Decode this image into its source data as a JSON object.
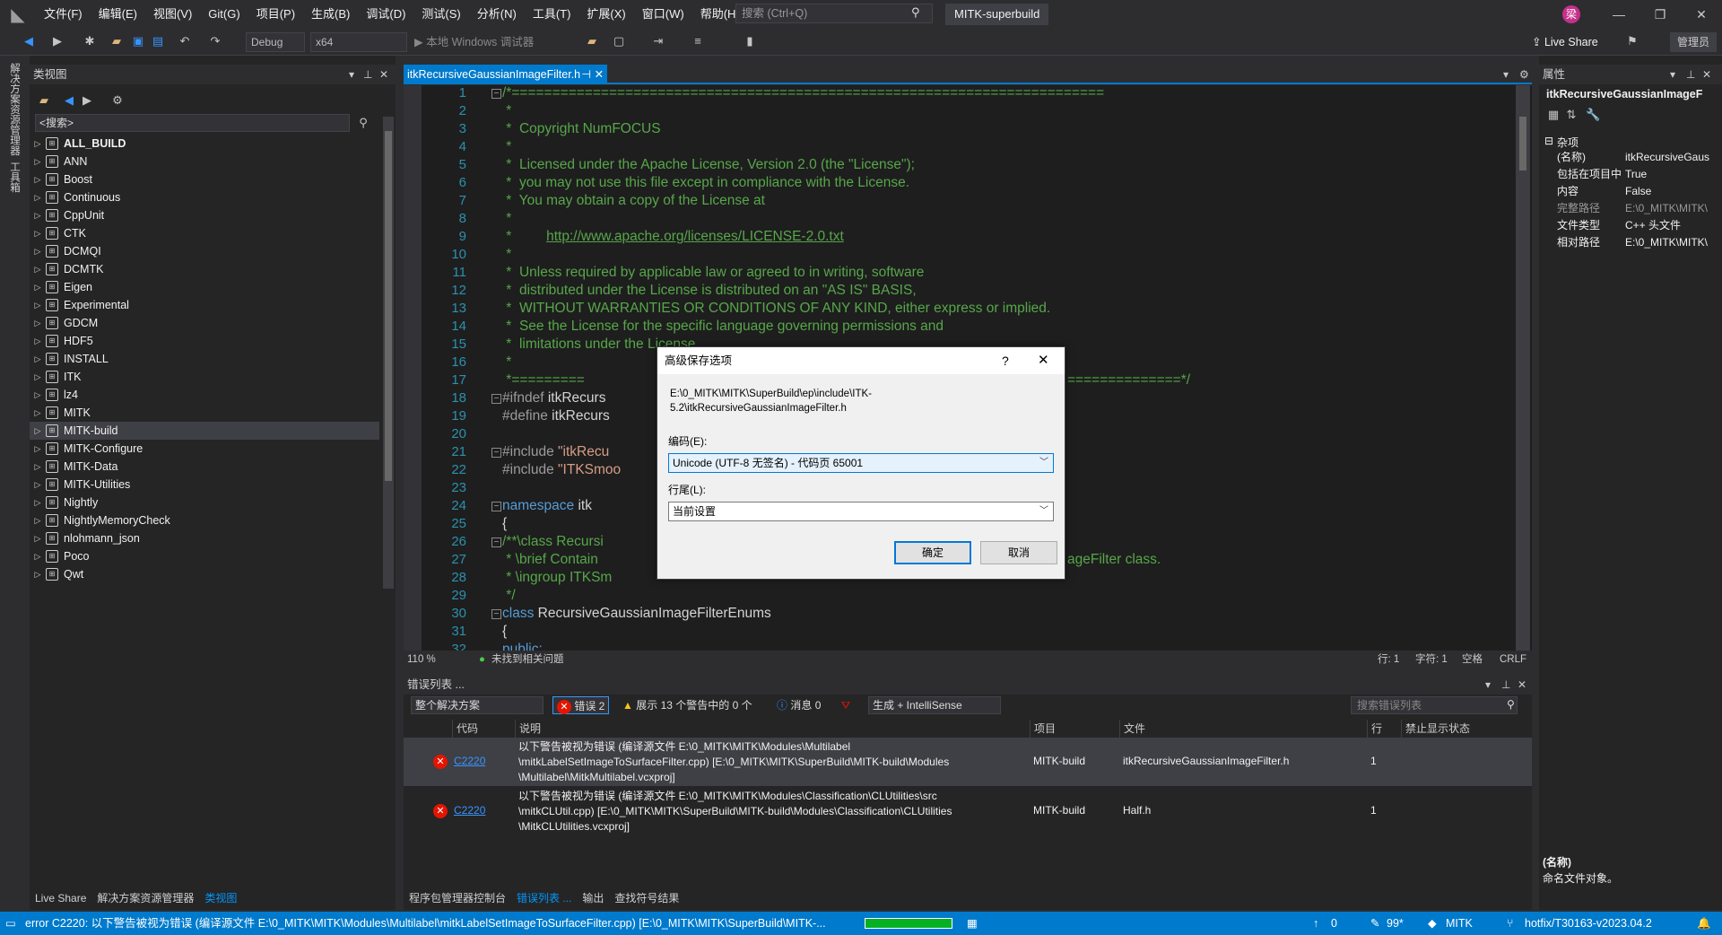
{
  "menubar": {
    "items": [
      "文件(F)",
      "编辑(E)",
      "视图(V)",
      "Git(G)",
      "项目(P)",
      "生成(B)",
      "调试(D)",
      "测试(S)",
      "分析(N)",
      "工具(T)",
      "扩展(X)",
      "窗口(W)",
      "帮助(H)"
    ],
    "search_placeholder": "搜索 (Ctrl+Q)",
    "solution_name": "MITK-superbuild",
    "avatar_initial": "梁"
  },
  "toolbar": {
    "config": "Debug",
    "platform": "x64",
    "debug_target": "本地 Windows 调试器",
    "live_share": "Live Share",
    "admin_label": "管理员"
  },
  "leftstrip": {
    "tabs": [
      "解决方案资源管理器",
      "工具箱"
    ]
  },
  "classview": {
    "title": "类视图",
    "search_placeholder": "<搜索>",
    "items": [
      "ALL_BUILD",
      "ANN",
      "Boost",
      "Continuous",
      "CppUnit",
      "CTK",
      "DCMQI",
      "DCMTK",
      "Eigen",
      "Experimental",
      "GDCM",
      "HDF5",
      "INSTALL",
      "ITK",
      "lz4",
      "MITK",
      "MITK-build",
      "MITK-Configure",
      "MITK-Data",
      "MITK-Utilities",
      "Nightly",
      "NightlyMemoryCheck",
      "nlohmann_json",
      "Poco",
      "Qwt"
    ],
    "selected_item": "MITK-build",
    "bottom_tabs": [
      "Live Share",
      "解决方案资源管理器",
      "类视图"
    ]
  },
  "editor": {
    "tab_title": "itkRecursiveGaussianImageFilter.h",
    "zoom": "110 %",
    "issues": "未找到相关问题",
    "line": "行: 1",
    "char": "字符: 1",
    "space": "空格",
    "eol": "CRLF",
    "line_numbers": [
      "1",
      "2",
      "3",
      "4",
      "5",
      "6",
      "7",
      "8",
      "9",
      "10",
      "11",
      "12",
      "13",
      "14",
      "15",
      "16",
      "17",
      "18",
      "19",
      "20",
      "21",
      "22",
      "23",
      "24",
      "25",
      "26",
      "27",
      "28",
      "29",
      "30",
      "31",
      "32"
    ],
    "code": {
      "l1": "/*=========================================================================",
      "l2": " *",
      "l3": " *  Copyright NumFOCUS",
      "l4": " *",
      "l5": " *  Licensed under the Apache License, Version 2.0 (the \"License\");",
      "l6": " *  you may not use this file except in compliance with the License.",
      "l7": " *  You may obtain a copy of the License at",
      "l8": " *",
      "l9_pre": " *         ",
      "l9_link": "http://www.apache.org/licenses/LICENSE-2.0.txt",
      "l10": " *",
      "l11": " *  Unless required by applicable law or agreed to in writing, software",
      "l12": " *  distributed under the License is distributed on an \"AS IS\" BASIS,",
      "l13": " *  WITHOUT WARRANTIES OR CONDITIONS OF ANY KIND, either express or implied.",
      "l14": " *  See the License for the specific language governing permissions and",
      "l15": " *  limitations under the License.",
      "l16": " *",
      "l17_a": " *=========",
      "l17_b": "==============*/",
      "l18_kw": "#ifndef",
      "l18_rest": " itkRecurs",
      "l19_kw": "#define",
      "l19_rest": " itkRecurs",
      "l21_kw": "#include",
      "l21_str": " \"itkRecu",
      "l22_kw": "#include",
      "l22_str": " \"ITKSmoo",
      "l24_kw": "namespace",
      "l24_rest": " itk",
      "l25": "{",
      "l26": "/**\\class Recursi",
      "l27_a": " * \\brief Contain",
      "l27_b": "ageFilter class.",
      "l28": " * \\ingroup ITKSm",
      "l29": " */",
      "l30_kw": "class",
      "l30_rest": " RecursiveGaussianImageFilterEnums",
      "l31": "{",
      "l32_kw": "public:"
    }
  },
  "errorlist": {
    "title": "错误列表 ...",
    "scope": "整个解决方案",
    "errors_chip": "错误 2",
    "warnings_chip": "展示 13 个警告中的 0 个",
    "messages_chip": "消息 0",
    "build_scope": "生成 + IntelliSense",
    "search_placeholder": "搜索错误列表",
    "headers": [
      "代码",
      "说明",
      "项目",
      "文件",
      "行",
      "禁止显示状态"
    ],
    "rows": [
      {
        "code": "C2220",
        "desc1": "以下警告被视为错误 (编译源文件 E:\\0_MITK\\MITK\\Modules\\Multilabel",
        "desc2": "\\mitkLabelSetImageToSurfaceFilter.cpp) [E:\\0_MITK\\MITK\\SuperBuild\\MITK-build\\Modules",
        "desc3": "\\Multilabel\\MitkMultilabel.vcxproj]",
        "project": "MITK-build",
        "file": "itkRecursiveGaussianImageFilter.h",
        "line": "1"
      },
      {
        "code": "C2220",
        "desc1": "以下警告被视为错误 (编译源文件 E:\\0_MITK\\MITK\\Modules\\Classification\\CLUtilities\\src",
        "desc2": "\\mitkCLUtil.cpp) [E:\\0_MITK\\MITK\\SuperBuild\\MITK-build\\Modules\\Classification\\CLUtilities",
        "desc3": "\\MitkCLUtilities.vcxproj]",
        "project": "MITK-build",
        "file": "Half.h",
        "line": "1"
      }
    ],
    "bottom_tabs": [
      "程序包管理器控制台",
      "错误列表 ...",
      "输出",
      "查找符号结果"
    ]
  },
  "properties": {
    "title": "属性",
    "object": "itkRecursiveGaussianImageF",
    "category": "杂项",
    "rows": [
      {
        "k": "(名称)",
        "v": "itkRecursiveGaus"
      },
      {
        "k": "包括在项目中",
        "v": "True"
      },
      {
        "k": "内容",
        "v": "False"
      },
      {
        "k": "完整路径",
        "v": "E:\\0_MITK\\MITK\\"
      },
      {
        "k": "文件类型",
        "v": "C++ 头文件"
      },
      {
        "k": "相对路径",
        "v": "E:\\0_MITK\\MITK\\"
      }
    ],
    "desc_title": "(名称)",
    "desc_text": "命名文件对象。"
  },
  "statusbar": {
    "message": "error C2220: 以下警告被视为错误 (编译源文件 E:\\0_MITK\\MITK\\Modules\\Multilabel\\mitkLabelSetImageToSurfaceFilter.cpp) [E:\\0_MITK\\MITK\\SuperBuild\\MITK-...",
    "up_count": "0",
    "pen_count": "99*",
    "repo": "MITK",
    "branch": "hotfix/T30163-v2023.04.2"
  },
  "dialog": {
    "title": "高级保存选项",
    "help": "?",
    "path_line1": "E:\\0_MITK\\MITK\\SuperBuild\\ep\\include\\ITK-",
    "path_line2": "5.2\\itkRecursiveGaussianImageFilter.h",
    "encoding_label": "编码(E):",
    "encoding_value": "Unicode (UTF-8 无签名) - 代码页 65001",
    "eol_label": "行尾(L):",
    "eol_value": "当前设置",
    "ok": "确定",
    "cancel": "取消"
  },
  "colors": {
    "accent": "#007acc",
    "error": "#e51400",
    "comment": "#57a64a",
    "keyword": "#569cd6",
    "progress": "#06b025"
  }
}
